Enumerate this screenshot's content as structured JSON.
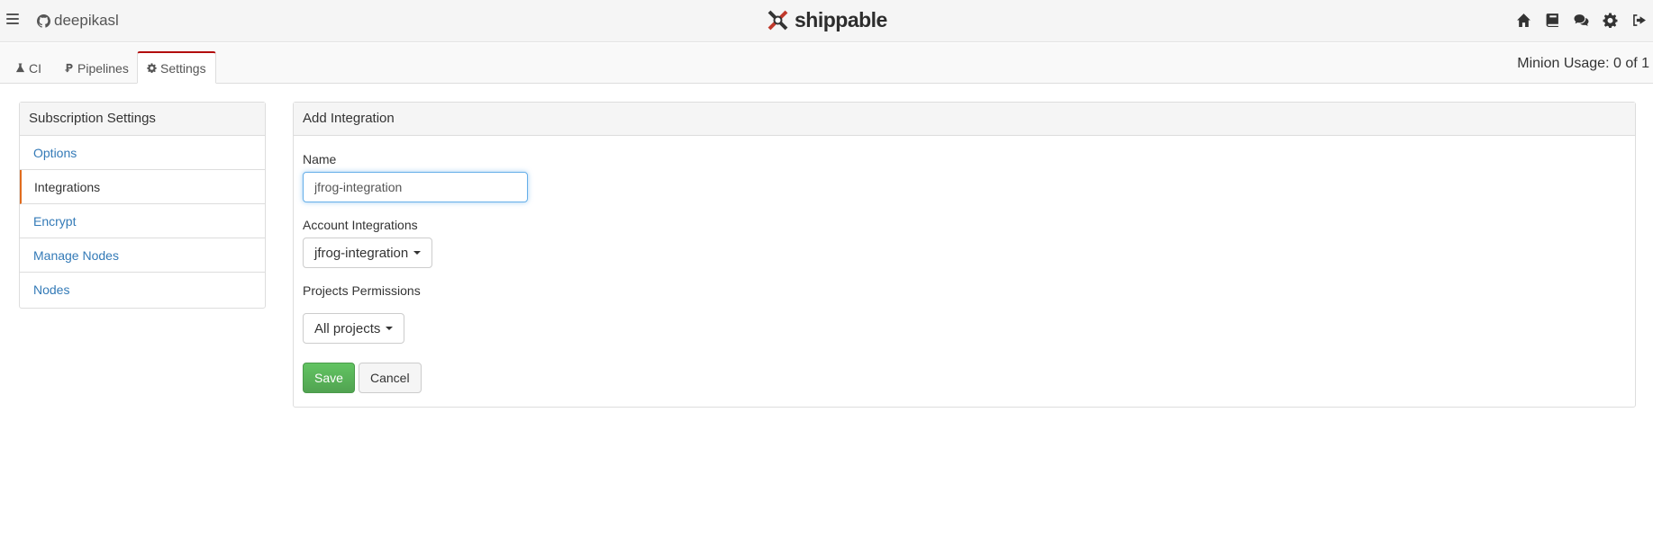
{
  "topbar": {
    "account": "deepikasl",
    "logo_text": "shippable",
    "icons": [
      "home-icon",
      "book-icon",
      "comments-icon",
      "gear-icon",
      "sign-out-icon"
    ]
  },
  "tabs": [
    {
      "label": "CI",
      "icon": "flask-icon"
    },
    {
      "label": "Pipelines",
      "icon": "pipeline-icon"
    },
    {
      "label": "Settings",
      "icon": "gear-icon",
      "active": true
    }
  ],
  "minion_usage": "Minion Usage: 0 of 1",
  "sidebar": {
    "title": "Subscription Settings",
    "items": [
      {
        "label": "Options"
      },
      {
        "label": "Integrations",
        "active": true
      },
      {
        "label": "Encrypt"
      },
      {
        "label": "Manage Nodes"
      },
      {
        "label": "Nodes"
      }
    ]
  },
  "form": {
    "title": "Add Integration",
    "name_label": "Name",
    "name_value": "jfrog-integration",
    "account_label": "Account Integrations",
    "account_value": "jfrog-integration",
    "projects_label": "Projects Permissions",
    "projects_value": "All projects",
    "save_label": "Save",
    "cancel_label": "Cancel"
  },
  "colors": {
    "active_tab_border": "#b20d0d",
    "active_menu_border": "#e06c1e",
    "link": "#337ab7",
    "save_button": "#5cb85c"
  }
}
